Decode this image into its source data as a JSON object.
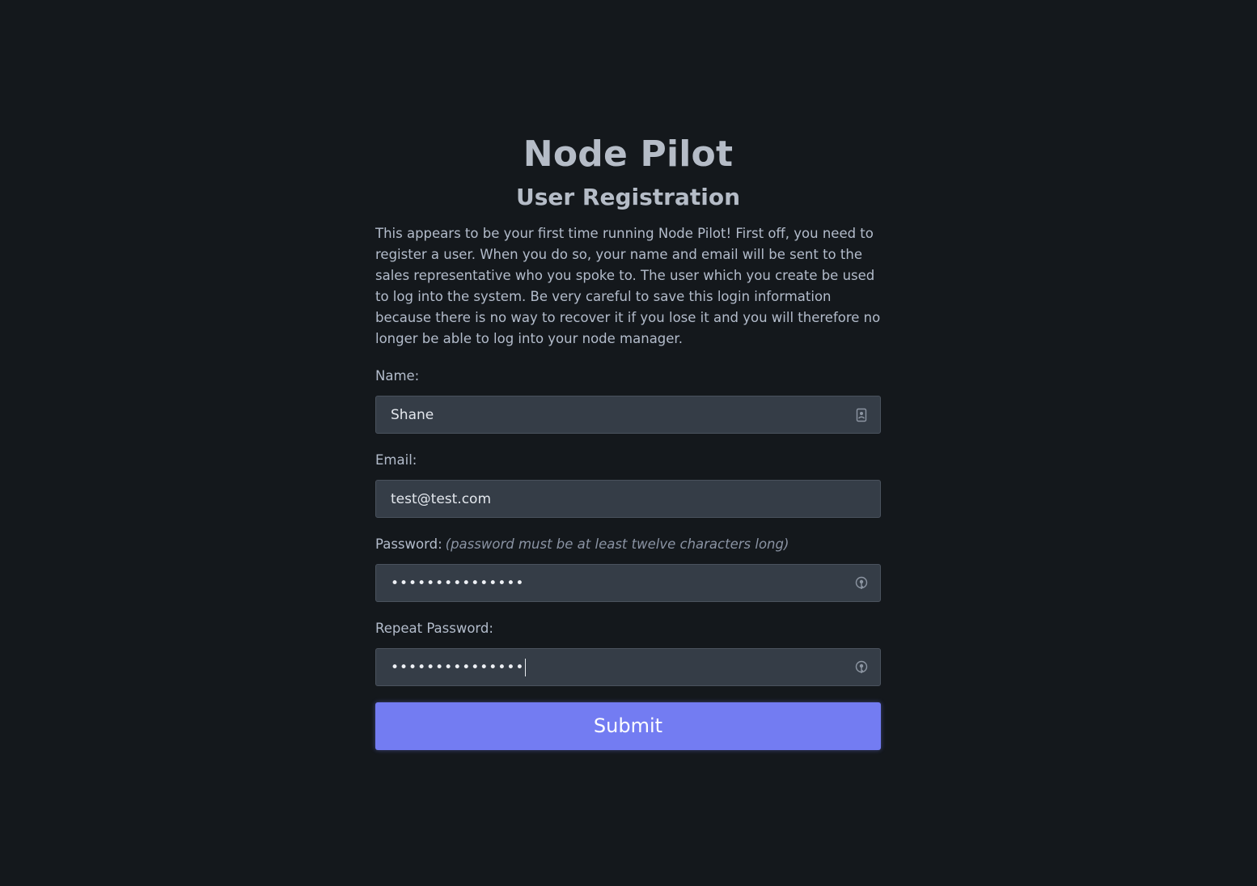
{
  "header": {
    "app_title": "Node Pilot",
    "page_title": "User Registration"
  },
  "intro_text": "This appears to be your first time running Node Pilot! First off, you need to register a user. When you do so, your name and email will be sent to the sales representative who you spoke to. The user which you create be used to log into the system. Be very careful to save this login information because there is no way to recover it if you lose it and you will therefore no longer be able to log into your node manager.",
  "form": {
    "name": {
      "label": "Name:",
      "value": "Shane",
      "icon": "contact-card-icon"
    },
    "email": {
      "label": "Email:",
      "value": "test@test.com"
    },
    "password": {
      "label": "Password:",
      "hint": "(password must be at least twelve characters long)",
      "value": "•••••••••••••••",
      "icon": "password-key-icon"
    },
    "repeat_password": {
      "label": "Repeat Password:",
      "value": "•••••••••••••••",
      "icon": "password-key-icon"
    },
    "submit_label": "Submit"
  },
  "colors": {
    "background": "#14181c",
    "input_background": "#353d47",
    "accent": "#737cf2"
  }
}
